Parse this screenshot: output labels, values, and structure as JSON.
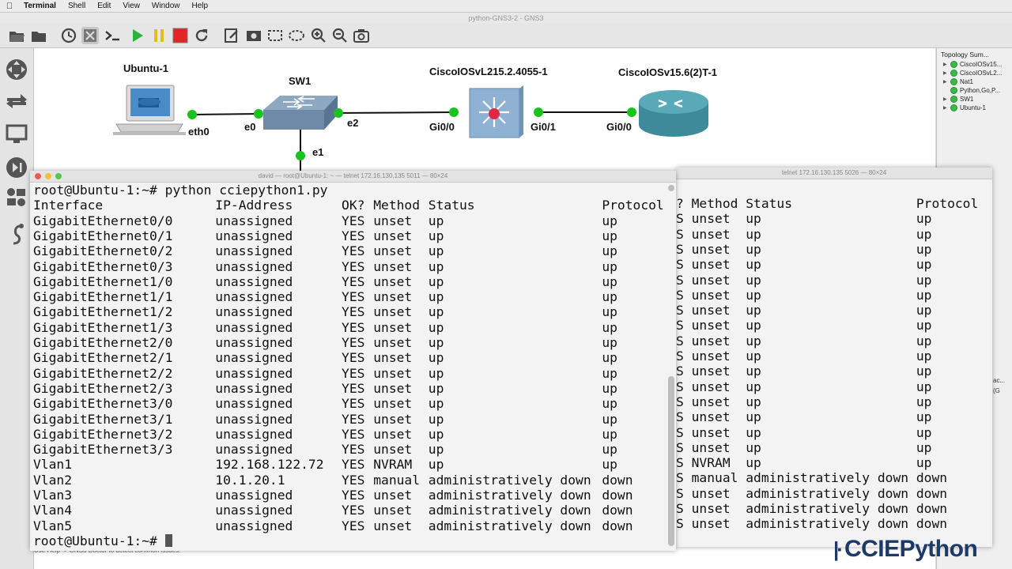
{
  "menubar": {
    "app": "Terminal",
    "items": [
      "Shell",
      "Edit",
      "View",
      "Window",
      "Help"
    ]
  },
  "gns3": {
    "window_title": "python-GNS3-2 - GNS3",
    "status_hint": "Use Help -> GNS3 Doctor to detect common issues."
  },
  "toolbar": {
    "icons": [
      "open-folder-icon",
      "folder-icon",
      "snapshot-clock-icon",
      "all-devices-icon",
      "console-icon",
      "start-icon",
      "pause-icon",
      "stop-icon",
      "reload-icon",
      "note-icon",
      "picture-icon",
      "rectangle-icon",
      "ellipse-icon",
      "zoom-in-icon",
      "zoom-out-icon",
      "screenshot-icon"
    ]
  },
  "topology": {
    "nodes": {
      "ubuntu": "Ubuntu-1",
      "sw1": "SW1",
      "l2switch": "CiscoIOSvL215.2.4055-1",
      "router": "CiscoIOSv15.6(2)T-1"
    },
    "ports": {
      "eth0": "eth0",
      "sw_e0": "e0",
      "sw_e2": "e2",
      "sw_e1": "e1",
      "l2_gi00": "Gi0/0",
      "l2_gi01": "Gi0/1",
      "rt_gi00": "Gi0/0"
    }
  },
  "topology_summary": {
    "title": "Topology Sum...",
    "items": [
      "CiscoIOSv15...",
      "CiscoIOSvL2...",
      "Nat1",
      "Python,Go,P...",
      "SW1",
      "Ubuntu-1"
    ],
    "extra": [
      "ac...",
      "(G"
    ]
  },
  "terminal_front": {
    "title": "david — root@Ubuntu-1: ~ — telnet 172.16.130.135 5011 — 80×24",
    "prompt_cmd": "root@Ubuntu-1:~# python cciepython1.py",
    "header": {
      "interface": "Interface",
      "ip": "IP-Address",
      "ok": "OK?",
      "method": "Method",
      "status": "Status",
      "protocol": "Protocol"
    },
    "rows": [
      {
        "interface": "GigabitEthernet0/0",
        "ip": "unassigned",
        "ok": "YES",
        "method": "unset",
        "status": "up",
        "protocol": "up"
      },
      {
        "interface": "GigabitEthernet0/1",
        "ip": "unassigned",
        "ok": "YES",
        "method": "unset",
        "status": "up",
        "protocol": "up"
      },
      {
        "interface": "GigabitEthernet0/2",
        "ip": "unassigned",
        "ok": "YES",
        "method": "unset",
        "status": "up",
        "protocol": "up"
      },
      {
        "interface": "GigabitEthernet0/3",
        "ip": "unassigned",
        "ok": "YES",
        "method": "unset",
        "status": "up",
        "protocol": "up"
      },
      {
        "interface": "GigabitEthernet1/0",
        "ip": "unassigned",
        "ok": "YES",
        "method": "unset",
        "status": "up",
        "protocol": "up"
      },
      {
        "interface": "GigabitEthernet1/1",
        "ip": "unassigned",
        "ok": "YES",
        "method": "unset",
        "status": "up",
        "protocol": "up"
      },
      {
        "interface": "GigabitEthernet1/2",
        "ip": "unassigned",
        "ok": "YES",
        "method": "unset",
        "status": "up",
        "protocol": "up"
      },
      {
        "interface": "GigabitEthernet1/3",
        "ip": "unassigned",
        "ok": "YES",
        "method": "unset",
        "status": "up",
        "protocol": "up"
      },
      {
        "interface": "GigabitEthernet2/0",
        "ip": "unassigned",
        "ok": "YES",
        "method": "unset",
        "status": "up",
        "protocol": "up"
      },
      {
        "interface": "GigabitEthernet2/1",
        "ip": "unassigned",
        "ok": "YES",
        "method": "unset",
        "status": "up",
        "protocol": "up"
      },
      {
        "interface": "GigabitEthernet2/2",
        "ip": "unassigned",
        "ok": "YES",
        "method": "unset",
        "status": "up",
        "protocol": "up"
      },
      {
        "interface": "GigabitEthernet2/3",
        "ip": "unassigned",
        "ok": "YES",
        "method": "unset",
        "status": "up",
        "protocol": "up"
      },
      {
        "interface": "GigabitEthernet3/0",
        "ip": "unassigned",
        "ok": "YES",
        "method": "unset",
        "status": "up",
        "protocol": "up"
      },
      {
        "interface": "GigabitEthernet3/1",
        "ip": "unassigned",
        "ok": "YES",
        "method": "unset",
        "status": "up",
        "protocol": "up"
      },
      {
        "interface": "GigabitEthernet3/2",
        "ip": "unassigned",
        "ok": "YES",
        "method": "unset",
        "status": "up",
        "protocol": "up"
      },
      {
        "interface": "GigabitEthernet3/3",
        "ip": "unassigned",
        "ok": "YES",
        "method": "unset",
        "status": "up",
        "protocol": "up"
      },
      {
        "interface": "Vlan1",
        "ip": "192.168.122.72",
        "ok": "YES",
        "method": "NVRAM",
        "status": "up",
        "protocol": "up"
      },
      {
        "interface": "Vlan2",
        "ip": "10.1.20.1",
        "ok": "YES",
        "method": "manual",
        "status": "administratively down",
        "protocol": "down"
      },
      {
        "interface": "Vlan3",
        "ip": "unassigned",
        "ok": "YES",
        "method": "unset",
        "status": "administratively down",
        "protocol": "down"
      },
      {
        "interface": "Vlan4",
        "ip": "unassigned",
        "ok": "YES",
        "method": "unset",
        "status": "administratively down",
        "protocol": "down"
      },
      {
        "interface": "Vlan5",
        "ip": "unassigned",
        "ok": "YES",
        "method": "unset",
        "status": "administratively down",
        "protocol": "down"
      }
    ],
    "final_prompt": "root@Ubuntu-1:~# "
  },
  "terminal_back": {
    "title": "telnet 172.16.130.135 5026 — 80×24",
    "header_visible": "? Method Status                Protocol",
    "lines": [
      "S unset  up                    up",
      "S unset  up                    up",
      "S unset  up                    up",
      "S unset  up                    up",
      "S unset  up                    up",
      "S unset  up                    up",
      "S unset  up                    up",
      "S unset  up                    up",
      "S unset  up                    up",
      "S unset  up                    up",
      "S unset  up                    up",
      "S unset  up                    up",
      "S unset  up                    up",
      "S unset  up                    up",
      "S unset  up                    up",
      "S unset  up                    up",
      "S NVRAM  up                    up",
      "S manual administratively down down",
      "S unset  administratively down down",
      "S unset  administratively down down",
      "S unset  administratively down down"
    ]
  },
  "brand": "CCIEPython",
  "colors": {
    "port_dot": "#19c31c",
    "brand": "#1d3a66",
    "link": "#111111"
  }
}
